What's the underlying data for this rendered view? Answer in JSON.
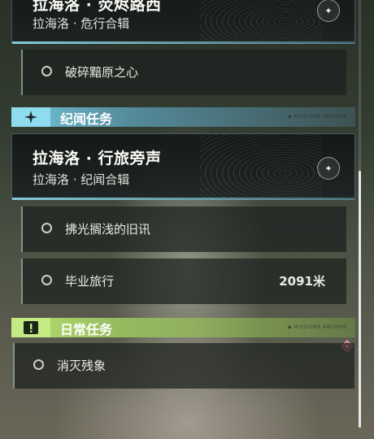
{
  "top_card": {
    "title": "拉海洛 · 荧烬路西",
    "subtitle": "拉海洛 · 危行合辑"
  },
  "rows_top": [
    {
      "label": "破碎黯原之心"
    }
  ],
  "category_lore": {
    "label": "纪闻任务",
    "tag": "◆ MISSIONS ARCHIVE"
  },
  "lore_card": {
    "title": "拉海洛 · 行旅旁声",
    "subtitle": "拉海洛 · 纪闻合辑"
  },
  "rows_lore": [
    {
      "label": "拂光搁浅的旧讯",
      "distance": ""
    },
    {
      "label": "毕业旅行",
      "distance": "2091米"
    }
  ],
  "category_daily": {
    "label": "日常任务",
    "tag": "◆ MISSIONS ARCHIVE"
  },
  "rows_daily": [
    {
      "label": "消灭残象"
    }
  ],
  "colors": {
    "lore_accent": "#7fd6ea",
    "daily_accent": "#b6e37a",
    "alert": "#e0505a"
  },
  "icons": {
    "lore": "sparkle-icon",
    "daily": "exclamation-icon",
    "card_badge": "compass-icon",
    "alert": "diamond-alert-icon"
  }
}
